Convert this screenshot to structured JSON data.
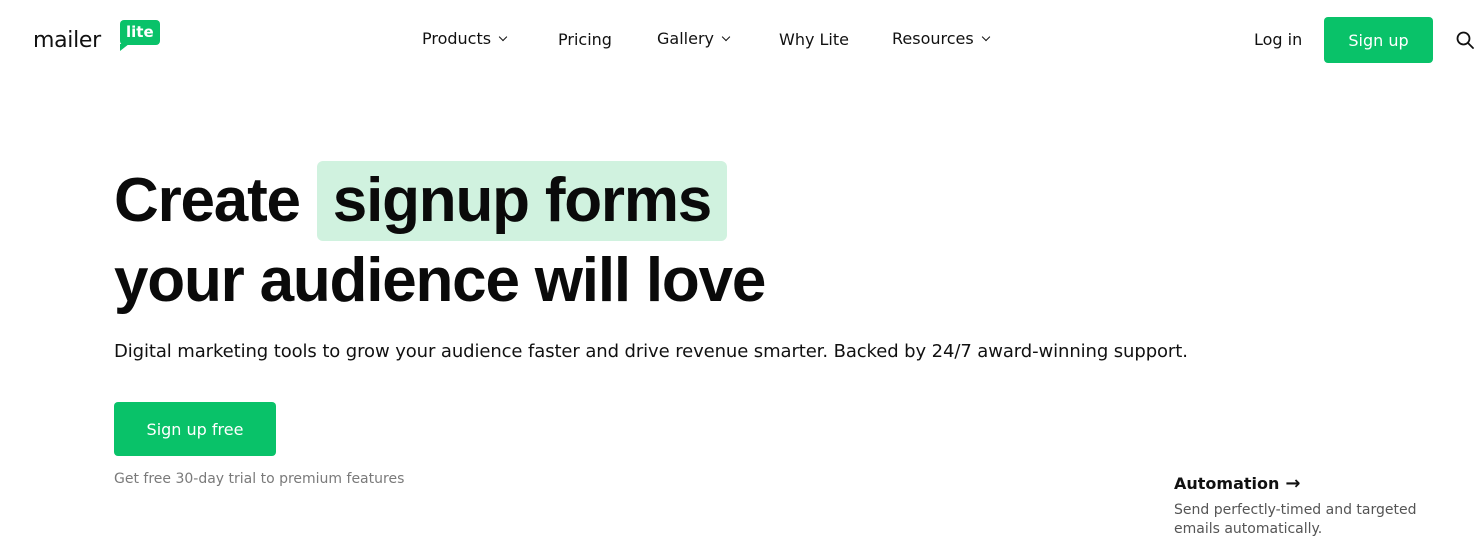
{
  "header": {
    "logo": {
      "text": "mailer",
      "badge": "lite"
    },
    "nav": [
      {
        "label": "Products",
        "has_dropdown": true
      },
      {
        "label": "Pricing",
        "has_dropdown": false
      },
      {
        "label": "Gallery",
        "has_dropdown": true
      },
      {
        "label": "Why Lite",
        "has_dropdown": false
      },
      {
        "label": "Resources",
        "has_dropdown": true
      }
    ],
    "login_label": "Log in",
    "signup_label": "Sign up",
    "search_icon": "search-icon"
  },
  "hero": {
    "headline_part1": "Create",
    "headline_highlight": "signup forms",
    "headline_line2": "your audience will love",
    "subtext": "Digital marketing tools to grow your audience faster and drive revenue smarter. Backed by 24/7 award-winning support.",
    "cta_label": "Sign up free",
    "trial_note": "Get free 30-day trial to premium features"
  },
  "feature": {
    "title": "Automation",
    "arrow": "→",
    "description": "Send perfectly-timed and targeted emails automatically."
  },
  "colors": {
    "accent": "#09c269",
    "highlight_bg": "#d0f2df",
    "text": "#111111",
    "muted": "#7a7a7a"
  }
}
